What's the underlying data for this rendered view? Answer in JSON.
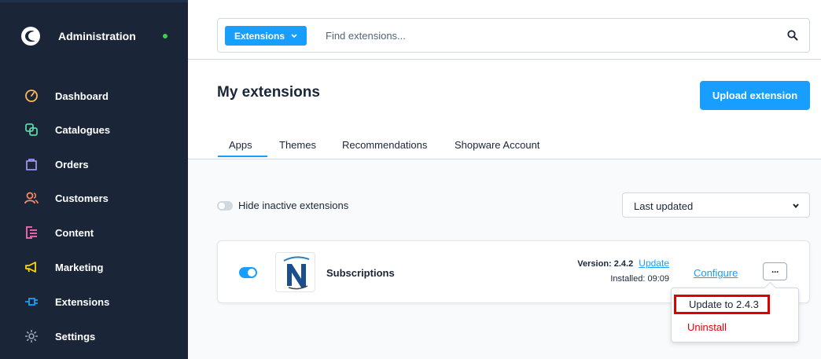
{
  "sidebar": {
    "title": "Administration",
    "items": [
      {
        "label": "Dashboard",
        "icon": "gauge-icon",
        "color": "#ffb75d"
      },
      {
        "label": "Catalogues",
        "icon": "catalogue-icon",
        "color": "#57d9a3"
      },
      {
        "label": "Orders",
        "icon": "shopping-bag-icon",
        "color": "#a092f0"
      },
      {
        "label": "Customers",
        "icon": "users-icon",
        "color": "#f88962"
      },
      {
        "label": "Content",
        "icon": "content-icon",
        "color": "#ff68b4"
      },
      {
        "label": "Marketing",
        "icon": "megaphone-icon",
        "color": "#ffd700"
      },
      {
        "label": "Extensions",
        "icon": "plug-icon",
        "color": "#189eff"
      },
      {
        "label": "Settings",
        "icon": "gear-icon",
        "color": "#9aa8b5"
      }
    ]
  },
  "search": {
    "scope_label": "Extensions",
    "placeholder": "Find extensions..."
  },
  "page": {
    "title": "My extensions",
    "upload_label": "Upload extension",
    "tabs": [
      "Apps",
      "Themes",
      "Recommendations",
      "Shopware Account"
    ],
    "active_tab": "Apps"
  },
  "filters": {
    "hide_inactive_label": "Hide inactive extensions",
    "sort_value": "Last updated"
  },
  "extension": {
    "name": "Subscriptions",
    "version_label": "Version: 2.4.2",
    "update_link": "Update",
    "installed_label": "Installed: 09:09",
    "configure_label": "Configure",
    "more_label": "···"
  },
  "context_menu": {
    "update_label": "Update to 2.4.3",
    "uninstall_label": "Uninstall"
  },
  "colors": {
    "accent": "#189eff",
    "sidebar_bg": "#1a2638",
    "danger": "#e50000",
    "status_online": "#37d046"
  }
}
